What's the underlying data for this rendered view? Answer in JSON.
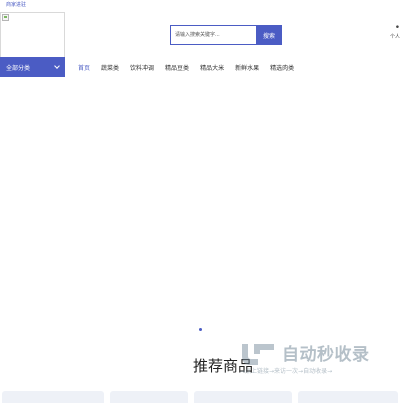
{
  "topbar": {
    "link_label": "商家进驻"
  },
  "search": {
    "placeholder": "请输入搜索关键字...",
    "button_label": "搜索"
  },
  "user": {
    "label": "个人"
  },
  "category": {
    "label": "全部分类"
  },
  "nav": {
    "items": [
      "首页",
      "蔬菜类",
      "饮料冲调",
      "精品豆类",
      "精品大米",
      "新鲜水果",
      "精选肉类"
    ],
    "active_index": 0
  },
  "section": {
    "title": "推荐商品"
  },
  "watermark": {
    "title": "自动秒收录",
    "subtitle": "→点上链接→来访一次→自动收录→"
  },
  "colors": {
    "accent": "#4b5cc4",
    "card_bg": "#eef1f7"
  }
}
